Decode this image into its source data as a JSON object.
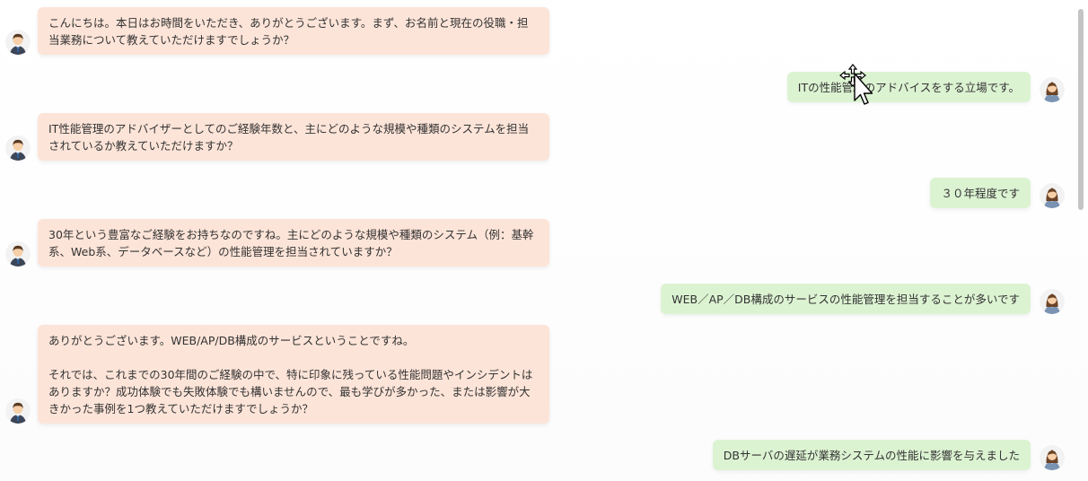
{
  "messages": [
    {
      "role": "bot",
      "text": "こんにちは。本日はお時間をいただき、ありがとうございます。まず、お名前と現在の役職・担当業務について教えていただけますでしょうか？"
    },
    {
      "role": "user",
      "text": "ITの性能管理のアドバイスをする立場です。"
    },
    {
      "role": "bot",
      "text": "IT性能管理のアドバイザーとしてのご経験年数と、主にどのような規模や種類のシステムを担当されているか教えていただけますか？"
    },
    {
      "role": "user",
      "text": "３０年程度です"
    },
    {
      "role": "bot",
      "text": "30年という豊富なご経験をお持ちなのですね。主にどのような規模や種類のシステム（例：基幹系、Web系、データベースなど）の性能管理を担当されていますか？"
    },
    {
      "role": "user",
      "text": "WEB／AP／DB構成のサービスの性能管理を担当することが多いです"
    },
    {
      "role": "bot",
      "text": "ありがとうございます。WEB/AP/DB構成のサービスということですね。\n\nそれでは、これまでの30年間のご経験の中で、特に印象に残っている性能問題やインシデントはありますか？成功体験でも失敗体験でも構いませんので、最も学びが多かった、または影響が大きかった事例を1つ教えていただけますでしょうか？"
    },
    {
      "role": "user",
      "text": "DBサーバの遅延が業務システムの性能に影響を与えました"
    }
  ],
  "colors": {
    "bot_bubble": "#fde4d8",
    "user_bubble": "#dcf3d2",
    "scrollbar": "#c4c4c4"
  },
  "icons": {
    "bot_avatar": "male-advisor-avatar-icon",
    "user_avatar": "female-user-avatar-icon",
    "cursor": "move-cursor-icon"
  }
}
